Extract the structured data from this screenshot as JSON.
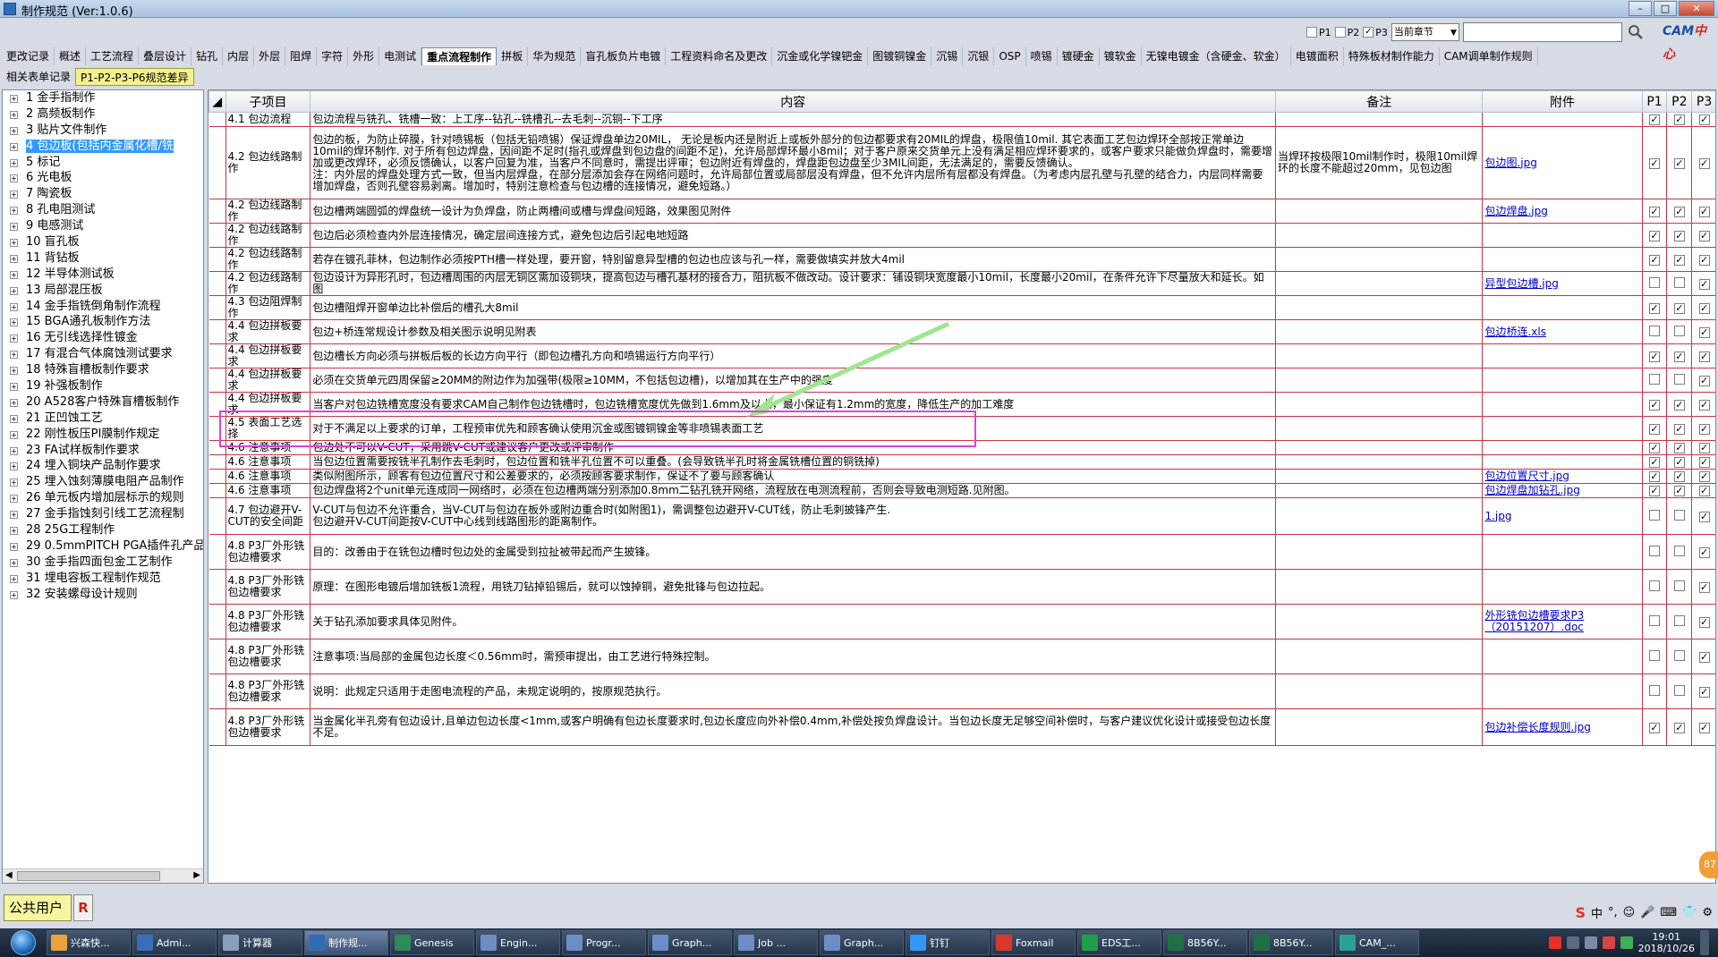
{
  "window": {
    "title": "制作规范 (Ver:1.0.6)",
    "controls": [
      "–",
      "□",
      "✕"
    ]
  },
  "topbar": {
    "filters": [
      {
        "label": "P1",
        "checked": false
      },
      {
        "label": "P2",
        "checked": false
      },
      {
        "label": "P3",
        "checked": true
      }
    ],
    "chapter_select": "当前章节",
    "search_placeholder": "",
    "logo_text": "CAM",
    "logo_text_red": "中心"
  },
  "tabs_row1": [
    "更改记录",
    "概述",
    "工艺流程",
    "叠层设计",
    "钻孔",
    "内层",
    "外层",
    "阻焊",
    "字符",
    "外形",
    "电测试",
    "重点流程制作",
    "拼板",
    "华为规范",
    "盲孔板负片电镀",
    "工程资料命名及更改",
    "沉金或化学镍钯金",
    "图镀铜镍金",
    "沉锡",
    "沉银",
    "OSP",
    "喷锡",
    "镀硬金",
    "镀软金",
    "无镍电镀金（含硬金、软金）",
    "电镀面积",
    "特殊板材制作能力",
    "CAM调单制作规则"
  ],
  "tabs_row1_active": 11,
  "tabs_row2": [
    "相关表单记录",
    "P1-P2-P3-P6规范差异"
  ],
  "tabs_row2_active": 1,
  "tree": [
    "1 金手指制作",
    "2 高频板制作",
    "3 贴片文件制作",
    "4 包边板(包括内金属化槽/铣",
    "5 标记",
    "6 光电板",
    "7 陶瓷板",
    "8 孔电阻测试",
    "9 电感测试",
    "10 盲孔板",
    "11 背钻板",
    "12 半导体测试板",
    "13 局部混压板",
    "14 金手指铣倒角制作流程",
    "15 BGA通孔板制作方法",
    "16 无引线选择性镀金",
    "17 有混合气体腐蚀测试要求",
    "18 特殊盲槽板制作要求",
    "19 补强板制作",
    "20 A528客户特殊盲槽板制作",
    "21 正凹蚀工艺",
    "22 刚性板压PI膜制作规定",
    "23 FA试样板制作要求",
    "24 埋入铜块产品制作要求",
    "25 埋入蚀刻薄膜电阻产品制作",
    "26 单元板内增加层标示的规则",
    "27 金手指蚀刻引线工艺流程制",
    "28 25G工程制作",
    "29 0.5mmPITCH PGA插件孔产品",
    "30 金手指四面包金工艺制作",
    "31 埋电容板工程制作规范",
    "32 安装螺母设计规则"
  ],
  "tree_selected": 3,
  "grid": {
    "headers": {
      "section": "子项目",
      "content": "内容",
      "remark": "备注",
      "attachment": "附件",
      "p1": "P1",
      "p2": "P2",
      "p3": "P3"
    },
    "rows": [
      {
        "section": "4.1 包边流程",
        "content": "包边流程与铣孔、铣槽一致：上工序--钻孔--铣槽孔--去毛刺--沉铜--下工序",
        "remark": "",
        "attachment": "",
        "p1": true,
        "p2": true,
        "p3": true
      },
      {
        "section": "4.2 包边线路制作",
        "content": "包边的板，为防止碎膜，针对喷锡板（包括无铅喷锡）保证焊盘单边20MIL， 无论是板内还是附近上或板外部分的包边都要求有20MIL的焊盘，极限值10mil. 其它表面工艺包边焊环全部按正常单边10mil的焊环制作. 对于所有包边焊盘，因间距不足时(指孔或焊盘到包边盘的间距不足)，允许局部焊环最小8mil；对于客户原来交货单元上没有满足相应焊环要求的，或客户要求只能做负焊盘时，需要增加或更改焊环，必须反馈确认，以客户回复为准，当客户不同意时，需提出评审；包边附近有焊盘的，焊盘距包边盘至少3MIL间距，无法满足的，需要反馈确认。\n注：内外层的焊盘处理方式一致，但当内层焊盘，在部分层添加会存在网络问题时，允许局部位置或局部层没有焊盘，但不允许内层所有层都没有焊盘。（为考虑内层孔壁与孔壁的结合力，内层同样需要增加焊盘，否则孔壁容易剥离。增加时，特别注意检查与包边槽的连接情况，避免短路。）",
        "remark": "当焊环按极限10mil制作时，极限10mil焊环的长度不能超过20mm，见包边图",
        "attachment": "包边图.jpg",
        "p1": true,
        "p2": true,
        "p3": true
      },
      {
        "section": "4.2 包边线路制作",
        "content": "包边槽两端圆弧的焊盘统一设计为负焊盘，防止两槽间或槽与焊盘间短路，效果图见附件",
        "remark": "",
        "attachment": "包边焊盘.jpg",
        "p1": true,
        "p2": true,
        "p3": true
      },
      {
        "section": "4.2 包边线路制作",
        "content": "包边后必须检查内外层连接情况，确定层间连接方式，避免包边后引起电地短路",
        "remark": "",
        "attachment": "",
        "p1": true,
        "p2": true,
        "p3": true
      },
      {
        "section": "4.2 包边线路制作",
        "content": "若存在镀孔菲林，包边制作必须按PTH槽一样处理，要开窗，特别留意异型槽的包边也应该与孔一样，需要做填实并放大4mil",
        "remark": "",
        "attachment": "",
        "p1": true,
        "p2": true,
        "p3": true
      },
      {
        "section": "4.2 包边线路制作",
        "content": "包边设计为异形孔时，包边槽周围的内层无铜区需加设铜块，提高包边与槽孔基材的接合力，阻抗板不做改动。设计要求：铺设铜块宽度最小10mil，长度最小20mil，在条件允许下尽量放大和延长。如图",
        "remark": "",
        "attachment": "异型包边槽.jpg",
        "p1": false,
        "p2": false,
        "p3": true
      },
      {
        "section": "4.3 包边阻焊制作",
        "content": "包边槽阻焊开窗单边比补偿后的槽孔大8mil",
        "remark": "",
        "attachment": "",
        "p1": true,
        "p2": true,
        "p3": true
      },
      {
        "section": "4.4 包边拼板要求",
        "content": "包边+桥连常规设计参数及相关图示说明见附表",
        "remark": "",
        "attachment": "包边桥连.xls",
        "p1": false,
        "p2": false,
        "p3": true
      },
      {
        "section": "4.4 包边拼板要求",
        "content": "包边槽长方向必须与拼板后板的长边方向平行（即包边槽孔方向和喷锡运行方向平行）",
        "remark": "",
        "attachment": "",
        "p1": true,
        "p2": true,
        "p3": true
      },
      {
        "section": "4.4 包边拼板要求",
        "content": "必须在交货单元四周保留≥20MM的附边作为加强带(极限≥10MM，不包括包边槽)，以增加其在生产中的强度",
        "remark": "",
        "attachment": "",
        "p1": false,
        "p2": false,
        "p3": true
      },
      {
        "section": "4.4 包边拼板要求",
        "content": "当客户对包边铣槽宽度没有要求CAM自己制作包边铣槽时，包边铣槽宽度优先做到1.6mm及以上，最小保证有1.2mm的宽度，降低生产的加工难度",
        "remark": "",
        "attachment": "",
        "p1": true,
        "p2": true,
        "p3": true
      },
      {
        "section": "4.5 表面工艺选择",
        "content": "对于不满足以上要求的订单，工程预审优先和顾客确认使用沉金或图镀铜镍金等非喷锡表面工艺",
        "remark": "",
        "attachment": "",
        "p1": true,
        "p2": true,
        "p3": true
      },
      {
        "section": "4.6 注意事项",
        "content": "包边处不可以V-CUT，采用跳V-CUT或建议客户更改或评审制作",
        "remark": "",
        "attachment": "",
        "p1": true,
        "p2": true,
        "p3": true
      },
      {
        "section": "4.6 注意事项",
        "content": "当包边位置需要按铣半孔制作去毛刺时，包边位置和铣半孔位置不可以重叠。(会导致铣半孔时将金属铣槽位置的铜铣掉)",
        "remark": "",
        "attachment": "",
        "p1": true,
        "p2": true,
        "p3": true
      },
      {
        "section": "4.6 注意事项",
        "content": "类似附图所示，顾客有包边位置尺寸和公差要求的，必须按顾客要求制作，保证不了要与顾客确认",
        "remark": "",
        "attachment": "包边位置尺寸.jpg",
        "p1": true,
        "p2": true,
        "p3": true
      },
      {
        "section": "4.6 注意事项",
        "content": "包边焊盘将2个unit单元连成同一网络时，必须在包边槽两端分别添加0.8mm二钻孔铣开网络，流程放在电测流程前，否则会导致电测短路.见附图。",
        "remark": "",
        "attachment": "包边焊盘加钻孔.jpg",
        "p1": true,
        "p2": true,
        "p3": true
      },
      {
        "section": "4.7 包边避开V-CUT的安全间距",
        "content": "V-CUT与包边不允许重合，当V-CUT与包边在板外或附边重合时(如附图1)，需调整包边避开V-CUT线，防止毛刺披锋产生.\n包边避开V-CUT间距按V-CUT中心线到线路图形的距离制作。",
        "remark": "",
        "attachment": "1.jpg",
        "p1": false,
        "p2": false,
        "p3": true
      },
      {
        "section": "4.8 P3厂外形铣包边槽要求",
        "content": "目的：改善由于在铣包边槽时包边处的金属受到拉扯被带起而产生披锋。",
        "remark": "",
        "attachment": "",
        "p1": false,
        "p2": false,
        "p3": true
      },
      {
        "section": "4.8 P3厂外形铣包边槽要求",
        "content": "原理：在图形电镀后增加铣板1流程，用铣刀钻掉铅锡后，就可以蚀掉铜，避免批锋与包边拉起。",
        "remark": "",
        "attachment": "",
        "p1": false,
        "p2": false,
        "p3": true
      },
      {
        "section": "4.8 P3厂外形铣包边槽要求",
        "content": "关于钻孔添加要求具体见附件。",
        "remark": "",
        "attachment": "外形铣包边槽要求P3（20151207）.doc",
        "p1": false,
        "p2": false,
        "p3": true
      },
      {
        "section": "4.8 P3厂外形铣包边槽要求",
        "content": "注意事项:当局部的金属包边长度＜0.56mm时，需预审提出，由工艺进行特殊控制。",
        "remark": "",
        "attachment": "",
        "p1": false,
        "p2": false,
        "p3": true
      },
      {
        "section": "4.8 P3厂外形铣包边槽要求",
        "content": "说明：此规定只适用于走图电流程的产品，未规定说明的，按原规范执行。",
        "remark": "",
        "attachment": "",
        "p1": false,
        "p2": false,
        "p3": true
      },
      {
        "section": "4.8 P3厂外形铣包边槽要求",
        "content": "当金属化半孔旁有包边设计,且单边包边长度<1mm,或客户明确有包边长度要求时,包边长度应向外补偿0.4mm,补偿处按负焊盘设计。当包边长度无足够空间补偿时，与客户建议优化设计或接受包边长度不足。",
        "remark": "",
        "attachment": "包边补偿长度规则.jpg",
        "p1": true,
        "p2": true,
        "p3": true
      }
    ]
  },
  "float_badge": "87",
  "status": {
    "user": "公共用户",
    "role": "R"
  },
  "ime": [
    "中",
    "°,",
    "☺",
    "🎤",
    "⌨",
    "👕",
    "⚙"
  ],
  "taskbar": {
    "items": [
      {
        "label": "兴森快...",
        "color": "#e8a33c"
      },
      {
        "label": "Admi...",
        "color": "#3a6fb8"
      },
      {
        "label": "计算器",
        "color": "#8aa0b8"
      },
      {
        "label": "制作规...",
        "color": "#2f6db5",
        "active": true
      },
      {
        "label": "Genesis",
        "color": "#2e8b57"
      },
      {
        "label": "Engin...",
        "color": "#6b8ec7"
      },
      {
        "label": "Progr...",
        "color": "#6b8ec7"
      },
      {
        "label": "Graph...",
        "color": "#6b8ec7"
      },
      {
        "label": "Job ...",
        "color": "#6b8ec7"
      },
      {
        "label": "Graph...",
        "color": "#6b8ec7"
      },
      {
        "label": "钉钉",
        "color": "#3296fa"
      },
      {
        "label": "Foxmail",
        "color": "#d8392b"
      },
      {
        "label": "EDS工...",
        "color": "#1e9e4a"
      },
      {
        "label": "8B56Y...",
        "color": "#1e7145"
      },
      {
        "label": "8B56Y...",
        "color": "#1e7145"
      },
      {
        "label": "CAM_...",
        "color": "#2aa198"
      }
    ],
    "clock_time": "19:01",
    "clock_date": "2018/10/26"
  }
}
